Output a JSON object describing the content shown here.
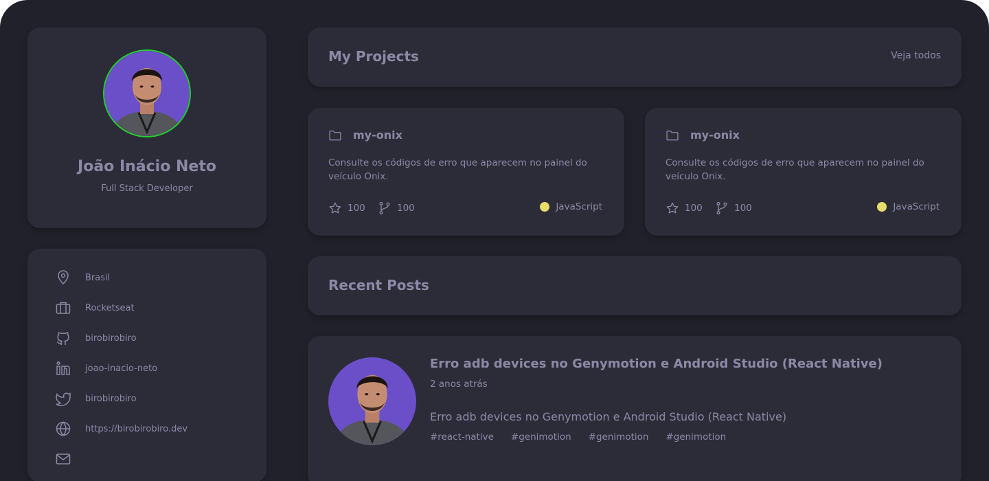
{
  "profile": {
    "name": "João Inácio Neto",
    "role": "Full Stack Developer"
  },
  "info": [
    {
      "icon": "map-pin-icon",
      "text": "Brasil"
    },
    {
      "icon": "briefcase-icon",
      "text": "Rocketseat"
    },
    {
      "icon": "github-icon",
      "text": "birobirobiro"
    },
    {
      "icon": "linkedin-icon",
      "text": "joao-inacio-neto"
    },
    {
      "icon": "twitter-icon",
      "text": "birobirobiro"
    },
    {
      "icon": "globe-icon",
      "text": "https://birobirobiro.dev"
    },
    {
      "icon": "mail-icon",
      "text": ""
    }
  ],
  "projects_section": {
    "title": "My Projects",
    "see_all": "Veja todos"
  },
  "projects": [
    {
      "name": "my-onix",
      "description": "Consulte os códigos de erro que aparecem no painel do veículo Onix.",
      "stars": "100",
      "forks": "100",
      "language": "JavaScript",
      "language_color": "#e8dd6a"
    },
    {
      "name": "my-onix",
      "description": "Consulte os códigos de erro que aparecem no painel do veículo Onix.",
      "stars": "100",
      "forks": "100",
      "language": "JavaScript",
      "language_color": "#e8dd6a"
    }
  ],
  "posts_section": {
    "title": "Recent Posts"
  },
  "posts": [
    {
      "title": "Erro adb devices no Genymotion e Android Studio (React Native)",
      "time": "2 anos atrás",
      "body": "Erro adb devices no Genymotion e Android Studio (React Native)",
      "tags": [
        "#react-native",
        "#genimotion",
        "#genimotion",
        "#genimotion"
      ]
    }
  ],
  "colors": {
    "background": "#21212b",
    "card": "#2c2c38",
    "text": "#8c89a6",
    "avatar_ring": "#23d02d",
    "avatar_bg": "#6a4fc8"
  }
}
